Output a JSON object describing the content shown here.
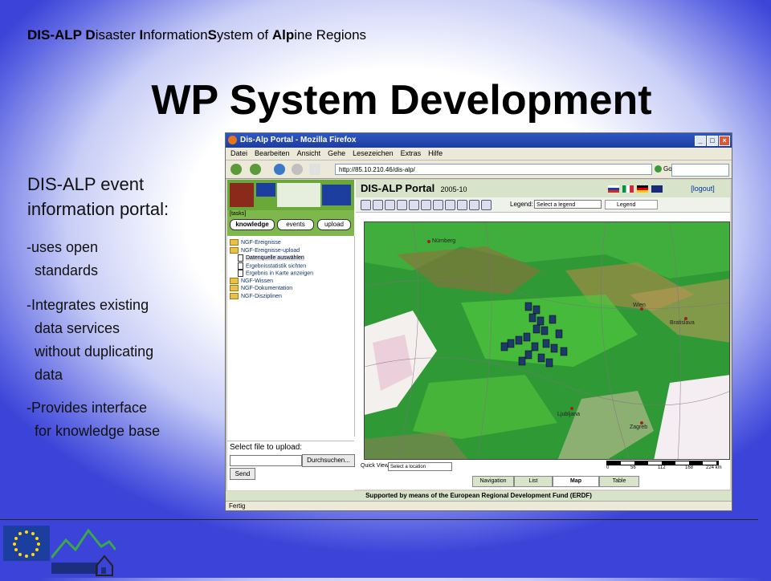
{
  "slide": {
    "header_parts": [
      {
        "text": "DIS-ALP ",
        "bold": true
      },
      {
        "text": "D",
        "bold": true
      },
      {
        "text": "isaster ",
        "bold": false
      },
      {
        "text": "I",
        "bold": true
      },
      {
        "text": "nformation",
        "bold": false
      },
      {
        "text": "S",
        "bold": true
      },
      {
        "text": "ystem of ",
        "bold": false
      },
      {
        "text": "Alp",
        "bold": true
      },
      {
        "text": "ine Regions",
        "bold": false
      }
    ],
    "title": "WP System Development",
    "lead_line1": "DIS-ALP event",
    "lead_line2": "information portal:",
    "bullets": [
      [
        "-uses open",
        "standards"
      ],
      [
        "-Integrates existing",
        "data services",
        "without duplicating",
        "data"
      ],
      [
        "-Provides interface",
        "for knowledge base"
      ]
    ]
  },
  "browser": {
    "window_title": "Dis-Alp Portal - Mozilla Firefox",
    "menu": [
      "Datei",
      "Bearbeiten",
      "Ansicht",
      "Gehe",
      "Lesezeichen",
      "Extras",
      "Hilfe"
    ],
    "url": "http://85.10.210.46/dis-alp/",
    "go_label": "Go",
    "status": "Fertig"
  },
  "portal": {
    "title": "DIS-ALP Portal",
    "version": "2005-10",
    "logout": "[logout]",
    "legend_label": "Legend:",
    "legend_select": "Select a legend",
    "legend_box": "Legend",
    "tasks_label": "[tasks]",
    "task_buttons": [
      "knowledge",
      "events",
      "upload"
    ],
    "tree": [
      {
        "label": "NGF-Ereignisse",
        "type": "folder",
        "indent": 0
      },
      {
        "label": "NGF-Ereignisse-upload",
        "type": "folder",
        "indent": 0
      },
      {
        "label": "Datenquelle auswählen",
        "type": "doc",
        "indent": 1
      },
      {
        "label": "Ergebnisstatistik sichten",
        "type": "doc",
        "indent": 1
      },
      {
        "label": "Ergebnis in Karte anzeigen",
        "type": "doc",
        "indent": 1
      },
      {
        "label": "NGF-Wissen",
        "type": "folder",
        "indent": 0
      },
      {
        "label": "NGF-Dokumentation",
        "type": "folder",
        "indent": 0
      },
      {
        "label": "NGF-Disziplinen",
        "type": "folder",
        "indent": 0
      }
    ],
    "upload_label": "Select file to upload:",
    "browse_label": "Durchsuchen...",
    "send_label": "Send",
    "quick_view_label": "Quick View:",
    "quick_view_select": "Select a location",
    "scale_ticks": [
      "0",
      "56",
      "112",
      "168",
      "224 km"
    ],
    "view_tabs": [
      "Navigation",
      "List",
      "Map",
      "Table"
    ],
    "active_tab": "Map",
    "footer": "Supported by means of the European Regional Development Fund (ERDF)",
    "map_cities": [
      "Nürnberg",
      "Wien",
      "Bratislava",
      "Ljubljana",
      "Zagreb"
    ]
  },
  "colors": {
    "slide_edge": "#3b43d8",
    "map_green": "#2f9a35",
    "portal_band": "#d8e4c9",
    "tasks_green": "#7eb84d"
  }
}
